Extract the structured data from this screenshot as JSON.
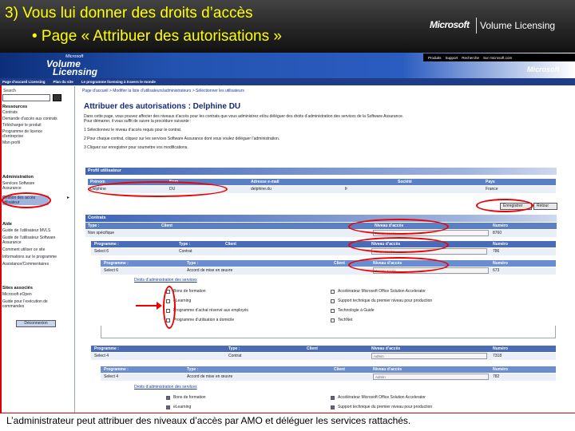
{
  "slide": {
    "title": "3) Vous lui donner des droits d’accès",
    "bullet": "• Page « Attribuer des autorisations »",
    "logo_ms": "Microsoft",
    "logo_vl": "Volume Licensing",
    "caption": "L’administrateur peut attribuer des niveaux d’accès par AMO et déléguer les services rattachés."
  },
  "site": {
    "brand_small": "Microsoft",
    "brand_line1": "Volume",
    "brand_line2": "Licensing",
    "ms_logo": "Microsoft",
    "top_links": [
      "Produits",
      "Support",
      "Recherche",
      "Sur microsoft.com"
    ],
    "nav": [
      "Page d’accueil Licensing",
      "Plan du site",
      "Le programme licensing à travers le monde"
    ]
  },
  "sidebar": {
    "search_label": "Search",
    "sections": [
      {
        "head": "Ressources",
        "items": [
          "Contrats",
          "Demande d’accès aux contrats",
          "Télécharger le produit",
          "Programme de licence d’entreprise",
          "Mon profil"
        ]
      },
      {
        "head": "Administration",
        "items": [
          "Services Software Assurance",
          "Gestion des accès utilisateur"
        ]
      },
      {
        "head": "Aide",
        "items": [
          "Guide de l’utilisateur MVLS",
          "Guide de l’utilisateur Software Assurance",
          "Comment utiliser ce site",
          "Informations sur le programme",
          "Assistance/Commentaires"
        ]
      },
      {
        "head": "Sites associés",
        "items": [
          "Microsoft eOpen",
          "Guide pour l’exécution de commandes"
        ]
      }
    ],
    "button": "Déconnexion"
  },
  "main": {
    "breadcrumb": "Page d’accueil  >  Modifier la liste d’utilisateurs/administrateurs  >  Sélectionner les utilisateurs",
    "title": "Attribuer des autorisations : Delphine DU",
    "intro": [
      "Dans cette page, vous pouvez affecter des niveaux d’accès pour les contrats que vous administrez et/ou déléguer des droits d’administration des services de la Software Assurance.",
      "Pour démarrer, il vous suffit de suivre la procédure suivante :",
      "1  Sélectionnez le niveau d’accès requis pour le contrat.",
      "2  Pour chaque contrat, cliquez sur les services Software Assurance dont vous voulez déléguer l’administration.",
      "3  Cliquez sur enregistrer pour soumettre vos modifications."
    ],
    "profile": {
      "header": "Profil utilisateur",
      "columns": [
        "Prénom",
        "Nom",
        "Adresse e-mail",
        "Société",
        "Pays"
      ],
      "row": [
        "Delphine",
        "DU",
        "delphine.du",
        "fr",
        "France"
      ],
      "buttons": [
        "Enregistrer",
        "Retour"
      ]
    },
    "contracts": {
      "header": "Contrats",
      "columns": [
        "Type :",
        "Client",
        "Niveau d’accès",
        "Numéro"
      ],
      "row": {
        "type": "Non spécifique",
        "access": "Aucun accès",
        "number": "8760"
      },
      "prog_header": [
        "Programme :",
        "Type :",
        "Client",
        "Niveau d’accès",
        "Numéro"
      ],
      "prog_row": {
        "program": "Select 6",
        "type": "Contrat",
        "access": "Aucun accès",
        "number": "786"
      },
      "sub_header": [
        "Programme :",
        "Type :",
        "Client",
        "Niveau d’accès",
        "Numéro"
      ],
      "sub_row": {
        "program": "Select 6",
        "type": "Accord de mise en œuvre",
        "access": "Aucun accès",
        "number": "673"
      },
      "services_title": "Droits d’administration des services",
      "services_left": [
        "Bons de formation",
        "eLearning",
        "Programme d’achat réservé aux employés",
        "Programme d’utilisation à domicile"
      ],
      "services_right": [
        "Accélérateur Microsoft Office Solution Accelerator",
        "Support technique du premier niveau pour production",
        "Technologie à Guide",
        "TechNet"
      ],
      "prog_header_2": [
        "Programme :",
        "Type :",
        "Client",
        "Niveau d’accès",
        "Numéro"
      ],
      "prog_row_2": {
        "program": "Select 4",
        "type": "Contrat",
        "access": "Admin",
        "number": "7318"
      },
      "sub_row_2": {
        "program": "Select 4",
        "type": "Accord de mise en œuvre",
        "access": "Admin",
        "number": "782"
      },
      "services_title_2": "Droits d’administration des services",
      "services_left_2": [
        "Bons de formation",
        "eLearning"
      ],
      "services_right_2": [
        "Accélérateur Microsoft Office Solution Accelerator",
        "Support technique du premier niveau pour production"
      ]
    }
  },
  "colors": {
    "slide_title": "#ffff00",
    "annotation": "#e00000",
    "banner": "#2353b0"
  }
}
